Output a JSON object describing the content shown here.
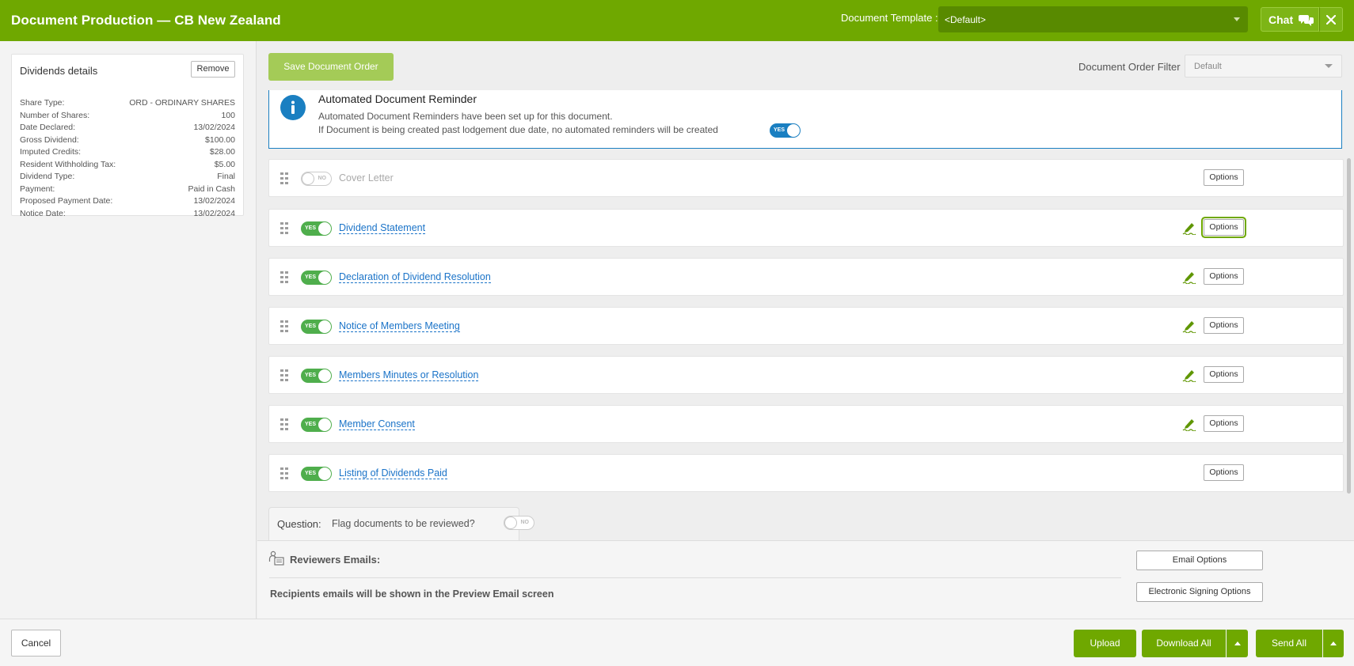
{
  "header": {
    "title": "Document Production — CB New Zealand",
    "template_label": "Document Template :",
    "template_value": "<Default>",
    "chat_label": "Chat",
    "accent_color": "#6fa800"
  },
  "dividends": {
    "title": "Dividends details",
    "remove_label": "Remove",
    "rows": [
      {
        "label": "Share Type:",
        "value": "ORD - ORDINARY SHARES"
      },
      {
        "label": "Number of Shares:",
        "value": "100"
      },
      {
        "label": "Date Declared:",
        "value": "13/02/2024"
      },
      {
        "label": "Gross Dividend:",
        "value": "$100.00"
      },
      {
        "label": "Imputed Credits:",
        "value": "$28.00"
      },
      {
        "label": "Resident Withholding Tax:",
        "value": "$5.00"
      },
      {
        "label": "Dividend Type:",
        "value": "Final"
      },
      {
        "label": "Payment:",
        "value": "Paid in Cash"
      },
      {
        "label": "Proposed Payment Date:",
        "value": "13/02/2024"
      },
      {
        "label": "Notice Date:",
        "value": "13/02/2024"
      }
    ]
  },
  "toolbar": {
    "save_order_label": "Save Document Order",
    "filter_label": "Document Order Filter",
    "filter_value": "Default"
  },
  "reminder": {
    "title": "Automated Document Reminder",
    "line1": "Automated Document Reminders have been set up for this document.",
    "line2": "If Document is being created past lodgement due date, no automated reminders will be created",
    "toggle_label": "YES"
  },
  "documents": [
    {
      "name": "Cover Letter",
      "enabled": false,
      "toggle_label": "NO",
      "signable": false,
      "options_label": "Options"
    },
    {
      "name": "Dividend Statement",
      "enabled": true,
      "toggle_label": "YES",
      "signable": true,
      "options_label": "Options"
    },
    {
      "name": "Declaration of Dividend Resolution",
      "enabled": true,
      "toggle_label": "YES",
      "signable": true,
      "options_label": "Options"
    },
    {
      "name": "Notice of Members Meeting",
      "enabled": true,
      "toggle_label": "YES",
      "signable": true,
      "options_label": "Options"
    },
    {
      "name": "Members Minutes or Resolution",
      "enabled": true,
      "toggle_label": "YES",
      "signable": true,
      "options_label": "Options"
    },
    {
      "name": "Member Consent",
      "enabled": true,
      "toggle_label": "YES",
      "signable": true,
      "options_label": "Options"
    },
    {
      "name": "Listing of Dividends Paid",
      "enabled": true,
      "toggle_label": "YES",
      "signable": false,
      "options_label": "Options"
    }
  ],
  "question": {
    "label": "Question:",
    "text": "Flag documents to be reviewed?",
    "toggle_label": "NO"
  },
  "reviewers": {
    "title": "Reviewers Emails:",
    "note": "Recipients emails will be shown in the Preview Email screen",
    "email_options_label": "Email Options",
    "esign_options_label": "Electronic Signing Options"
  },
  "footer": {
    "cancel_label": "Cancel",
    "upload_label": "Upload",
    "download_all_label": "Download All",
    "send_all_label": "Send All"
  }
}
